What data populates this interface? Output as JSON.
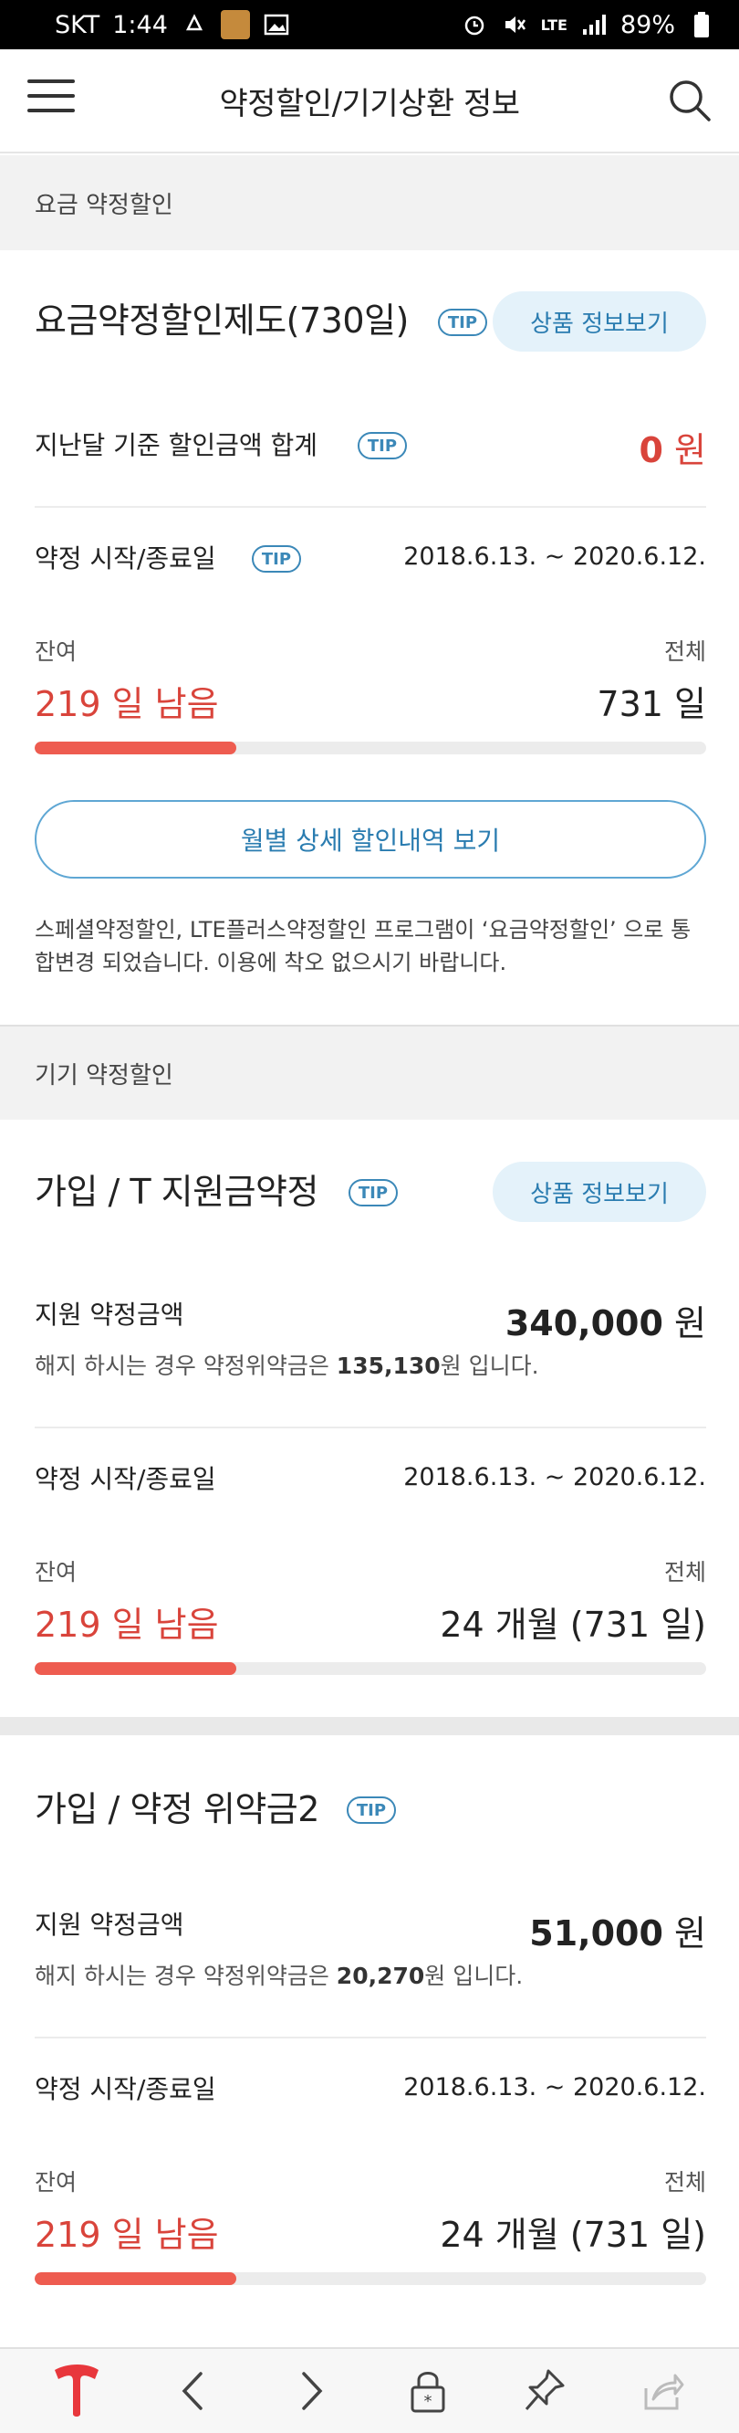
{
  "status": {
    "carrier": "SKT",
    "time": "1:44",
    "lte": "LTE",
    "battery": "89%"
  },
  "header": {
    "title": "약정할인/기기상환 정보"
  },
  "section1": {
    "head": "요금 약정할인",
    "title": "요금약정할인제도(730일)",
    "tip": "TIP",
    "info_btn": "상품 정보보기",
    "discount_label": "지난달 기준 할인금액 합계",
    "discount_value": "0",
    "won": "원",
    "period_label": "약정 시작/종료일",
    "period_value": "2018.6.13. ~ 2020.6.12.",
    "remain_label": "잔여",
    "total_label": "전체",
    "remain_value": "219 일 남음",
    "total_value": "731 일",
    "progress": 0.3,
    "monthly_btn": "월별 상세 할인내역 보기",
    "notice": "스페셜약정할인, LTE플러스약정할인 프로그램이 ‘요금약정할인’ 으로 통합변경 되었습니다. 이용에 착오 없으시기 바랍니다."
  },
  "section2": {
    "head": "기기 약정할인",
    "card1": {
      "title": "가입 / T 지원금약정",
      "tip": "TIP",
      "info_btn": "상품 정보보기",
      "support_label": "지원 약정금액",
      "support_value": "340,000",
      "won": "원",
      "penalty_pre": "해지 하시는 경우 약정위약금은 ",
      "penalty_value": "135,130",
      "penalty_post": "원 입니다.",
      "period_label": "약정 시작/종료일",
      "period_value": "2018.6.13. ~ 2020.6.12.",
      "remain_label": "잔여",
      "total_label": "전체",
      "remain_value": "219 일 남음",
      "total_value": "24 개월 (731 일)",
      "progress": 0.3
    },
    "card2": {
      "title": "가입 / 약정 위약금2",
      "tip": "TIP",
      "support_label": "지원 약정금액",
      "support_value": "51,000",
      "won": "원",
      "penalty_pre": "해지 하시는 경우 약정위약금은 ",
      "penalty_value": "20,270",
      "penalty_post": "원 입니다.",
      "period_label": "약정 시작/종료일",
      "period_value": "2018.6.13. ~ 2020.6.12.",
      "remain_label": "잔여",
      "total_label": "전체",
      "remain_value": "219 일 남음",
      "total_value": "24 개월 (731 일)",
      "progress": 0.3
    }
  },
  "bottomnav": {
    "items": [
      "t-logo-icon",
      "back-icon",
      "forward-icon",
      "lock-icon",
      "pin-icon",
      "share-icon"
    ]
  },
  "colors": {
    "accent_red": "#d9443b",
    "progress_red": "#ee5c50",
    "link_blue": "#2a7cb0"
  }
}
